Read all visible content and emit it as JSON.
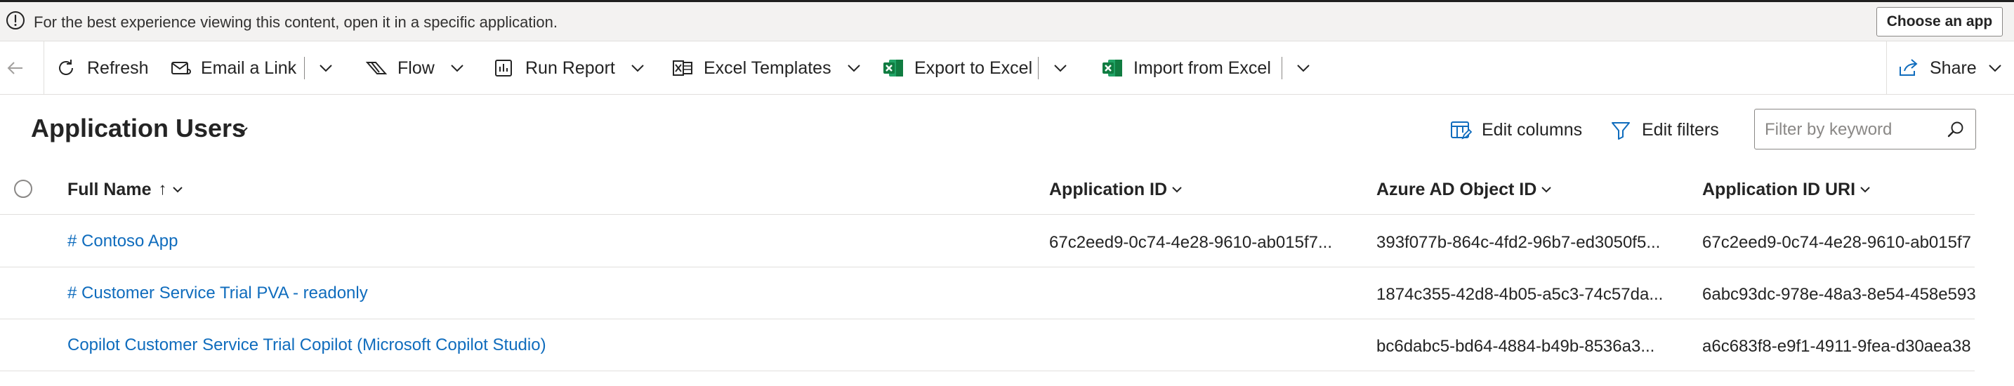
{
  "infobar": {
    "message": "For the best experience viewing this content, open it in a specific application.",
    "choose_app_label": "Choose an app"
  },
  "commandbar": {
    "refresh": "Refresh",
    "email_link": "Email a Link",
    "flow": "Flow",
    "run_report": "Run Report",
    "excel_templates": "Excel Templates",
    "export_excel": "Export to Excel",
    "import_excel": "Import from Excel",
    "share": "Share"
  },
  "view": {
    "title": "Application Users",
    "edit_columns": "Edit columns",
    "edit_filters": "Edit filters",
    "filter_placeholder": "Filter by keyword"
  },
  "grid": {
    "columns": {
      "full_name": "Full Name",
      "sort_indicator": "↑",
      "application_id": "Application ID",
      "azure_ad_object_id": "Azure AD Object ID",
      "application_id_uri": "Application ID URI"
    },
    "rows": [
      {
        "full_name": "# Contoso App",
        "application_id": "67c2eed9-0c74-4e28-9610-ab015f7...",
        "azure_ad_object_id": "393f077b-864c-4fd2-96b7-ed3050f5...",
        "application_id_uri": "67c2eed9-0c74-4e28-9610-ab015f7"
      },
      {
        "full_name": "# Customer Service Trial PVA - readonly",
        "application_id": "",
        "azure_ad_object_id": "1874c355-42d8-4b05-a5c3-74c57da...",
        "application_id_uri": "6abc93dc-978e-48a3-8e54-458e593"
      },
      {
        "full_name": "Copilot Customer Service Trial Copilot (Microsoft Copilot Studio)",
        "application_id": "",
        "azure_ad_object_id": "bc6dabc5-bd64-4884-b49b-8536a3...",
        "application_id_uri": "a6c683f8-e9f1-4911-9fea-d30aea38"
      }
    ]
  },
  "colors": {
    "link": "#0f6cbd",
    "excel_green": "#107c41",
    "text": "#242424",
    "infobar_bg": "#f3f2f1"
  },
  "icons": {
    "info": "info-circle-icon",
    "back": "back-arrow-icon",
    "refresh": "refresh-icon",
    "email": "email-link-icon",
    "flow": "flow-icon",
    "report": "report-icon",
    "excel_templates": "excel-templates-icon",
    "excel": "excel-icon",
    "share": "share-icon",
    "edit_columns": "edit-columns-icon",
    "filter": "filter-icon",
    "search": "search-icon",
    "chevron": "chevron-down-icon"
  }
}
